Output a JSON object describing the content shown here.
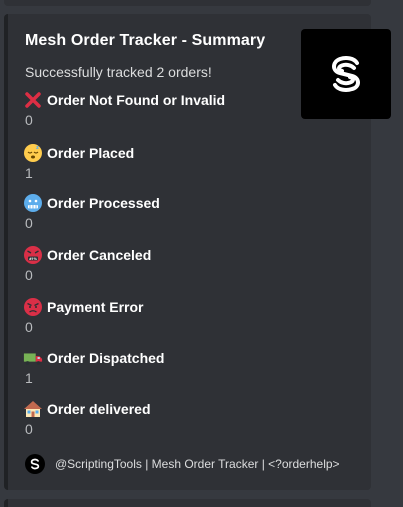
{
  "embed": {
    "title": "Mesh Order Tracker - Summary",
    "description": "Successfully tracked 2 orders!",
    "accent_color": "#202225",
    "thumbnail_icon": "mesh-s-logo"
  },
  "fields": [
    {
      "name": "Order Not Found or Invalid",
      "value": "0",
      "icon": "red-x-icon"
    },
    {
      "name": "Order Placed",
      "value": "1",
      "icon": "sleeping-face-icon"
    },
    {
      "name": "Order Processed",
      "value": "0",
      "icon": "cold-face-icon"
    },
    {
      "name": "Order Canceled",
      "value": "0",
      "icon": "cursing-face-icon"
    },
    {
      "name": "Payment Error",
      "value": "0",
      "icon": "angry-face-icon"
    },
    {
      "name": "Order Dispatched",
      "value": "1",
      "icon": "delivery-truck-icon"
    },
    {
      "name": "Order delivered",
      "value": "0",
      "icon": "house-icon"
    }
  ],
  "footer": {
    "text": "@ScriptingTools | Mesh Order Tracker | <?orderhelp>",
    "icon": "mesh-s-logo"
  }
}
